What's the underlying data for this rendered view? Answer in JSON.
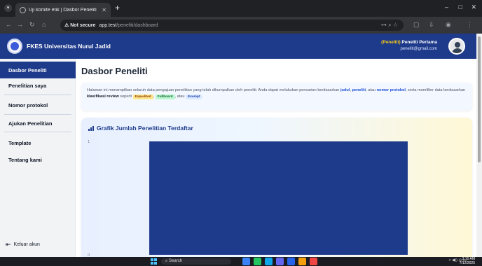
{
  "browser": {
    "tab_title": "Uji komite etik | Dasbor Peneliti",
    "new_tab": "+",
    "security_label": "Not secure",
    "url_host": "app.test",
    "url_path": "/peneliti/dashboard",
    "window_controls": [
      "–",
      "□",
      "✕"
    ]
  },
  "appbar": {
    "brand": "FKES Universitas Nurul Jadid",
    "user_role": "(Peneliti)",
    "user_name": "Peneliti Pertama",
    "user_email": "peneliti@gmail.com"
  },
  "sidebar": {
    "items": [
      {
        "label": "Dasbor Peneliti",
        "active": true
      },
      {
        "label": "Penelitian saya",
        "active": false
      },
      {
        "label": "Nomor protokol",
        "active": false
      },
      {
        "label": "Ajukan Penelitian",
        "active": false
      },
      {
        "label": "Template",
        "active": false
      },
      {
        "label": "Tentang kami",
        "active": false
      }
    ],
    "logout": "Keluar akun"
  },
  "main": {
    "title": "Dasbor Peneliti",
    "info": {
      "text1": "Halaman ini menampilkan seluruh data pengajuan penelitian yang telah dikumpulkan oleh peneliti. Anda dapat melakukan pencarian berdasarkan ",
      "link_judul": "judul",
      "sep1": ", ",
      "link_peneliti": "peneliti",
      "sep2": ", atau ",
      "link_nomor": "nomor protokol",
      "text2": ", serta memfilter data berdasarkan ",
      "bold_klasifikasi": "klasifikasi review",
      "text3": " seperti ",
      "chip_expedited": "Expedited",
      "sep3": ", ",
      "chip_fullboard": "Fullboard",
      "sep4": ", atau ",
      "chip_exempt": "Exempt",
      "text4": "."
    },
    "chart_title": "Grafik Jumlah Penelitian Terdaftar"
  },
  "chart_data": {
    "type": "bar",
    "categories": [
      ""
    ],
    "values": [
      1
    ],
    "ylim": [
      0,
      1
    ],
    "ytick_labels": [
      "0",
      "1"
    ],
    "title": "Grafik Jumlah Penelitian Terdaftar",
    "bar_color": "#1e3a8a",
    "grid": false
  },
  "taskbar": {
    "search": "Search",
    "time": "3:10 AM",
    "date": "7/12/2025"
  }
}
